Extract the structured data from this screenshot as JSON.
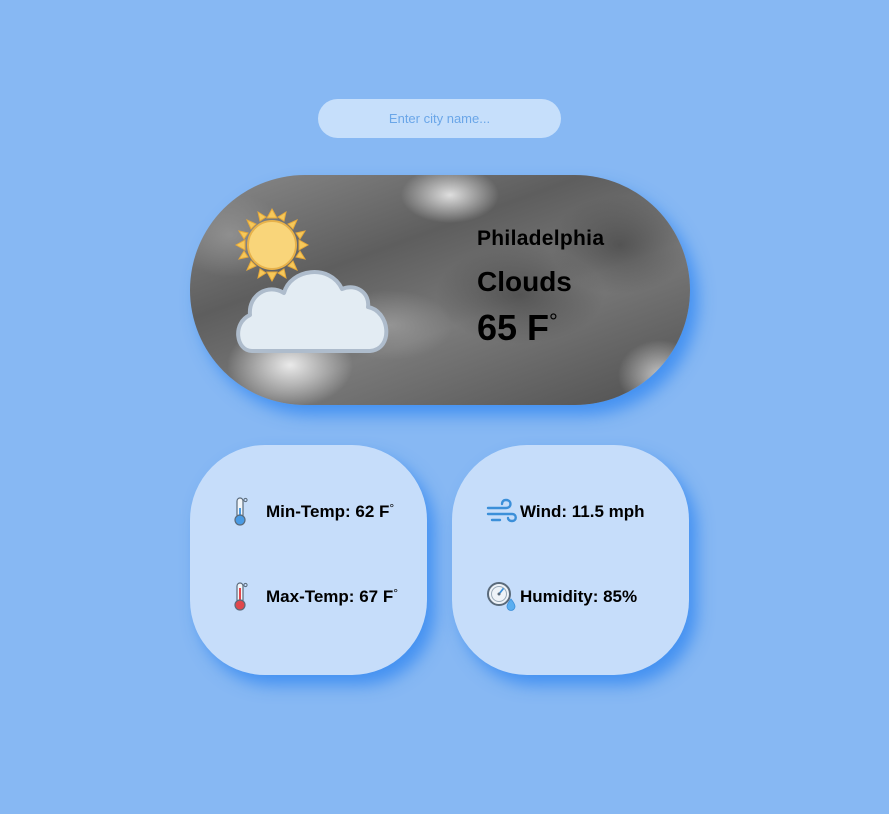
{
  "search": {
    "placeholder": "Enter city name..."
  },
  "current": {
    "city": "Philadelphia",
    "condition": "Clouds",
    "temperature": "65 F",
    "degree_symbol": "°",
    "icon": "partly-cloudy-icon"
  },
  "details": {
    "min_temp": {
      "label": "Min-Temp: 62 F",
      "degree_symbol": "°",
      "icon": "thermometer-cold-icon"
    },
    "max_temp": {
      "label": "Max-Temp: 67 F",
      "degree_symbol": "°",
      "icon": "thermometer-hot-icon"
    },
    "wind": {
      "label": "Wind: 11.5 mph",
      "icon": "wind-icon"
    },
    "humidity": {
      "label": "Humidity: 85%",
      "icon": "humidity-gauge-icon"
    }
  },
  "colors": {
    "background": "#87b8f3",
    "card": "#c6ddfa",
    "shadow": "#2e84f0",
    "placeholder": "#6aa6e8"
  }
}
